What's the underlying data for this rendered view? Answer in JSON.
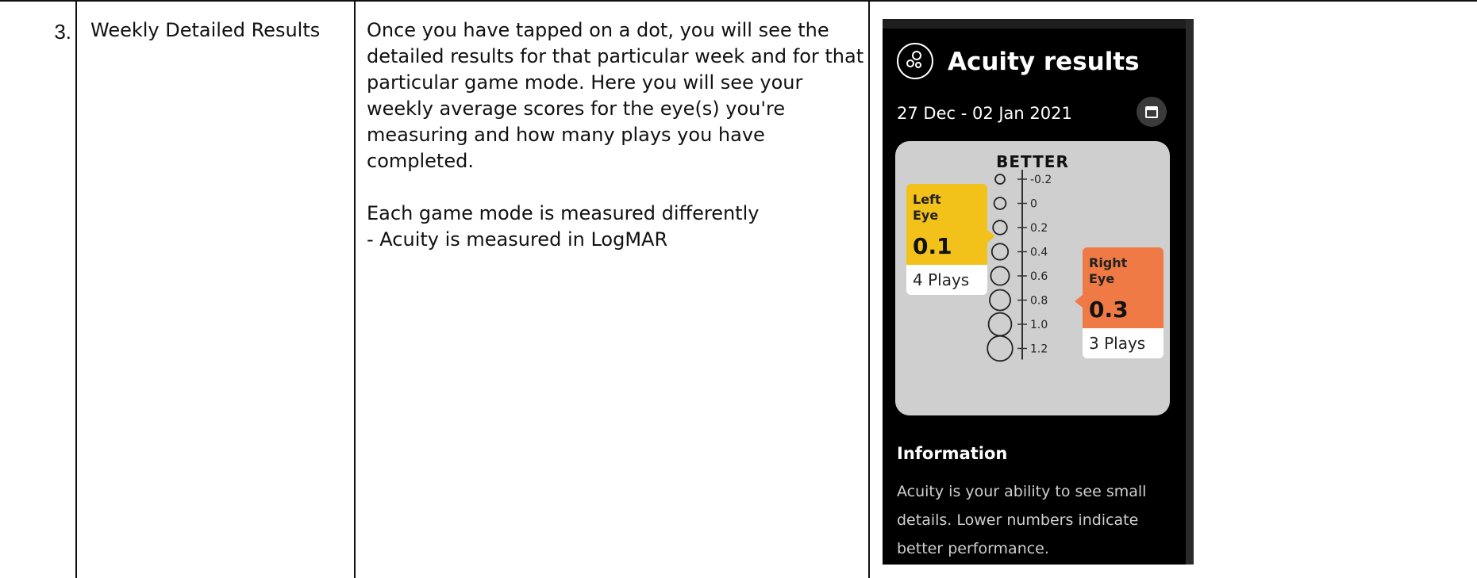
{
  "row": {
    "number": "3.",
    "feature": "Weekly Detailed Results",
    "description": "Once you have tapped on a dot, you will see the detailed results for that particular week and for that particular game mode. Here you will see your weekly average scores for the eye(s) you're measuring and how many plays you have completed.\n\nEach game mode is measured differently\n- Acuity is measured in LogMAR"
  },
  "screen": {
    "title": "Acuity results",
    "title_icon": "circles-icon",
    "date_range": "27 Dec - 02 Jan 2021",
    "calendar_icon": "calendar-icon",
    "scale_header": "BETTER",
    "scale_ticks": [
      "-0.2",
      "0",
      "0.2",
      "0.4",
      "0.6",
      "0.8",
      "1.0",
      "1.2"
    ],
    "left_eye": {
      "label": "Left\nEye",
      "value": "0.1",
      "plays": "4 Plays",
      "color": "#f2c21a"
    },
    "right_eye": {
      "label": "Right\nEye",
      "value": "0.3",
      "plays": "3 Plays",
      "color": "#ef7a45"
    },
    "info_title": "Information",
    "info_text": "Acuity is your ability to see small details. Lower numbers indicate better performance."
  }
}
